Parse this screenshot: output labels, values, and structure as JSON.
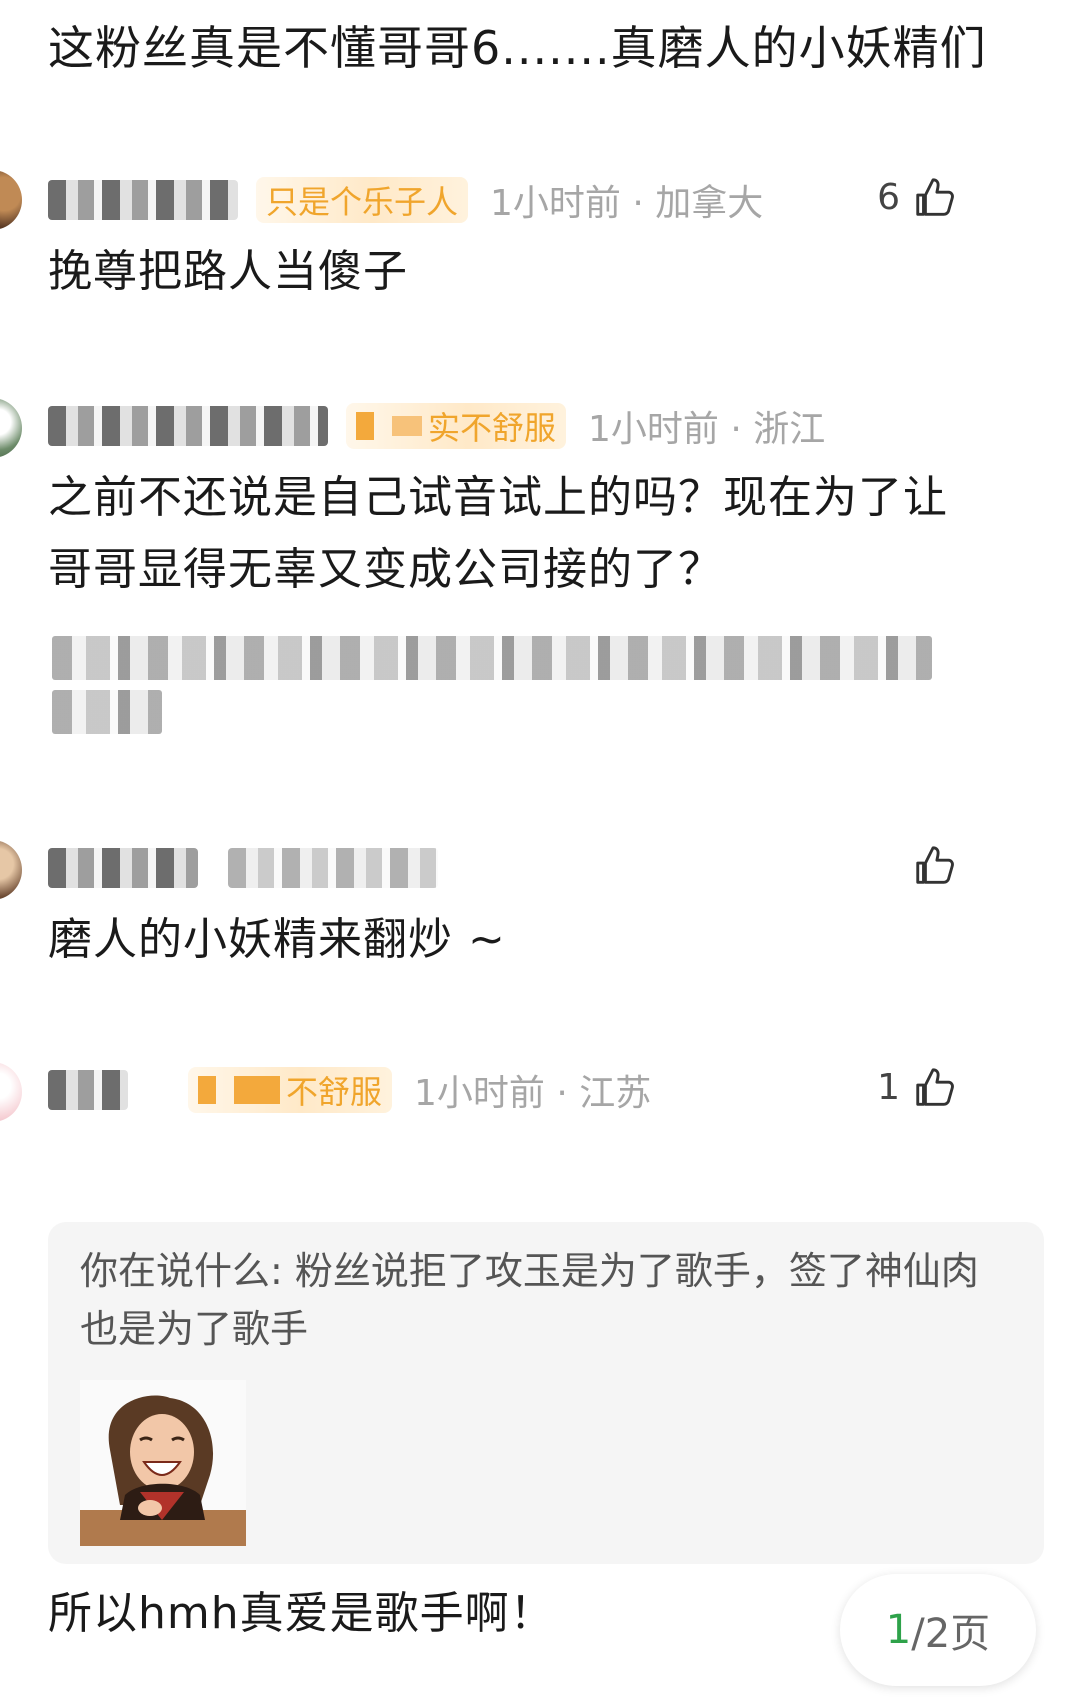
{
  "top_comment": {
    "text": "这粉丝真是不懂哥哥6.......真磨人的小妖精们"
  },
  "comments": [
    {
      "badge_text": "只是个乐子人",
      "time": "1小时前",
      "location": "加拿大",
      "likes": "6",
      "text": "挽尊把路人当傻子"
    },
    {
      "badge_text": "实不舒服",
      "time": "1小时前",
      "location": "浙江",
      "likes": "",
      "text": "之前不还说是自己试音试上的吗？现在为了让哥哥显得无辜又变成公司接的了？"
    },
    {
      "badge_text": "",
      "time": "",
      "location": "",
      "likes": "",
      "text": "磨人的小妖精来翻炒 ~"
    },
    {
      "badge_text": "不舒服",
      "time": "1小时前",
      "location": "江苏",
      "likes": "1",
      "quoted": "你在说什么: 粉丝说拒了攻玉是为了歌手，签了神仙肉也是为了歌手",
      "text": "所以hmh真爱是歌手啊！"
    }
  ],
  "separator": "·",
  "pager": {
    "current": "1",
    "total_label": "/2页"
  },
  "colors": {
    "badge_text": "#f0a52c",
    "meta_gray": "#a6a6a6",
    "pager_current": "#2ea24a",
    "reply_bg": "#f5f5f5"
  }
}
